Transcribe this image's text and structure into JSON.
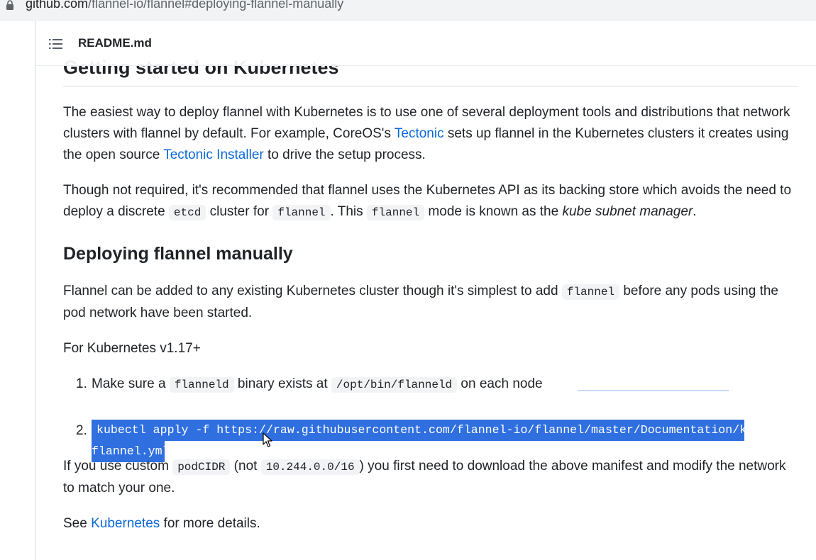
{
  "browser": {
    "url_host": "github.com",
    "url_path": "/flannel-io/flannel#deploying-flannel-manually",
    "lock_icon": "lock-icon"
  },
  "readme": {
    "toc_icon": "list-unordered-icon",
    "file_name": "README.md"
  },
  "section_kubernetes": {
    "heading": "Getting started on Kubernetes",
    "p1_a": "The easiest way to deploy flannel with Kubernetes is to use one of several deployment tools and distributions that network clusters with flannel by default. For example, CoreOS's ",
    "p1_link1": "Tectonic",
    "p1_b": " sets up flannel in the Kubernetes clusters it creates using the open source ",
    "p1_link2": "Tectonic Installer",
    "p1_c": " to drive the setup process.",
    "p2_a": "Though not required, it's recommended that flannel uses the Kubernetes API as its backing store which avoids the need to deploy a discrete ",
    "p2_code1": "etcd",
    "p2_b": " cluster for ",
    "p2_code2": "flannel",
    "p2_c": ". This ",
    "p2_code3": "flannel",
    "p2_d": " mode is known as the ",
    "p2_em": "kube subnet manager",
    "p2_e": "."
  },
  "section_manual": {
    "heading": "Deploying flannel manually",
    "p1_a": "Flannel can be added to any existing Kubernetes cluster though it's simplest to add ",
    "p1_code": "flannel",
    "p1_b": " before any pods using the pod network have been started.",
    "version_line": "For Kubernetes v1.17+",
    "step1_num": "1.",
    "step1_a": "Make sure a ",
    "step1_code1": "flanneld",
    "step1_b": " binary exists at ",
    "step1_code2": "/opt/bin/flanneld",
    "step1_c": " on each node",
    "step2_num": "2.",
    "step2_line1": "kubectl apply -f https://raw.githubusercontent.com/flannel-io/flannel/master/Documentation/kube-",
    "step2_line2": "flannel.yml",
    "p2_a": "If you use custom ",
    "p2_code1": "podCIDR",
    "p2_b": " (not ",
    "p2_code2": "10.244.0.0/16",
    "p2_c": ") you first need to download the above manifest and modify the network to match your one.",
    "p3_a": "See ",
    "p3_link": "Kubernetes",
    "p3_b": " for more details."
  },
  "colors": {
    "link": "#0969da",
    "selection": "#2f6fe0",
    "code_bg": "#f1f3f5"
  }
}
